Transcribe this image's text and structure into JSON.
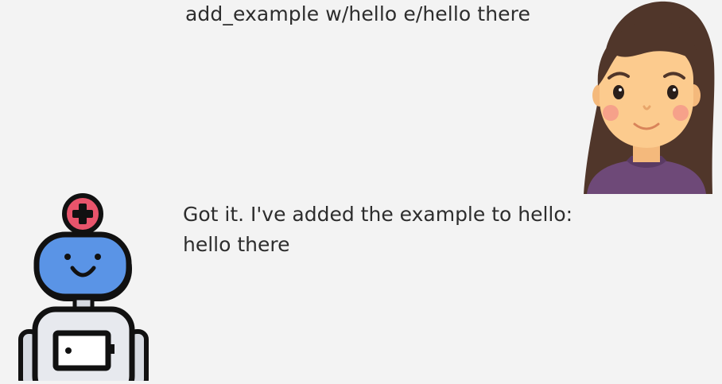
{
  "conversation": {
    "user_message": {
      "text": "add_example w/hello e/hello there",
      "avatar_icon": "user-woman-avatar-icon"
    },
    "bot_message": {
      "line1": "Got it. I've added the example to hello:",
      "line2": "hello there",
      "avatar_icon": "robot-avatar-icon"
    }
  },
  "colors": {
    "background": "#f3f3f3",
    "text": "#2d2d2d",
    "robot_head": "#5a94e6",
    "robot_badge": "#e8546b",
    "user_hair": "#50362a",
    "user_skin": "#fccb8e",
    "user_shirt": "#6e4978"
  }
}
